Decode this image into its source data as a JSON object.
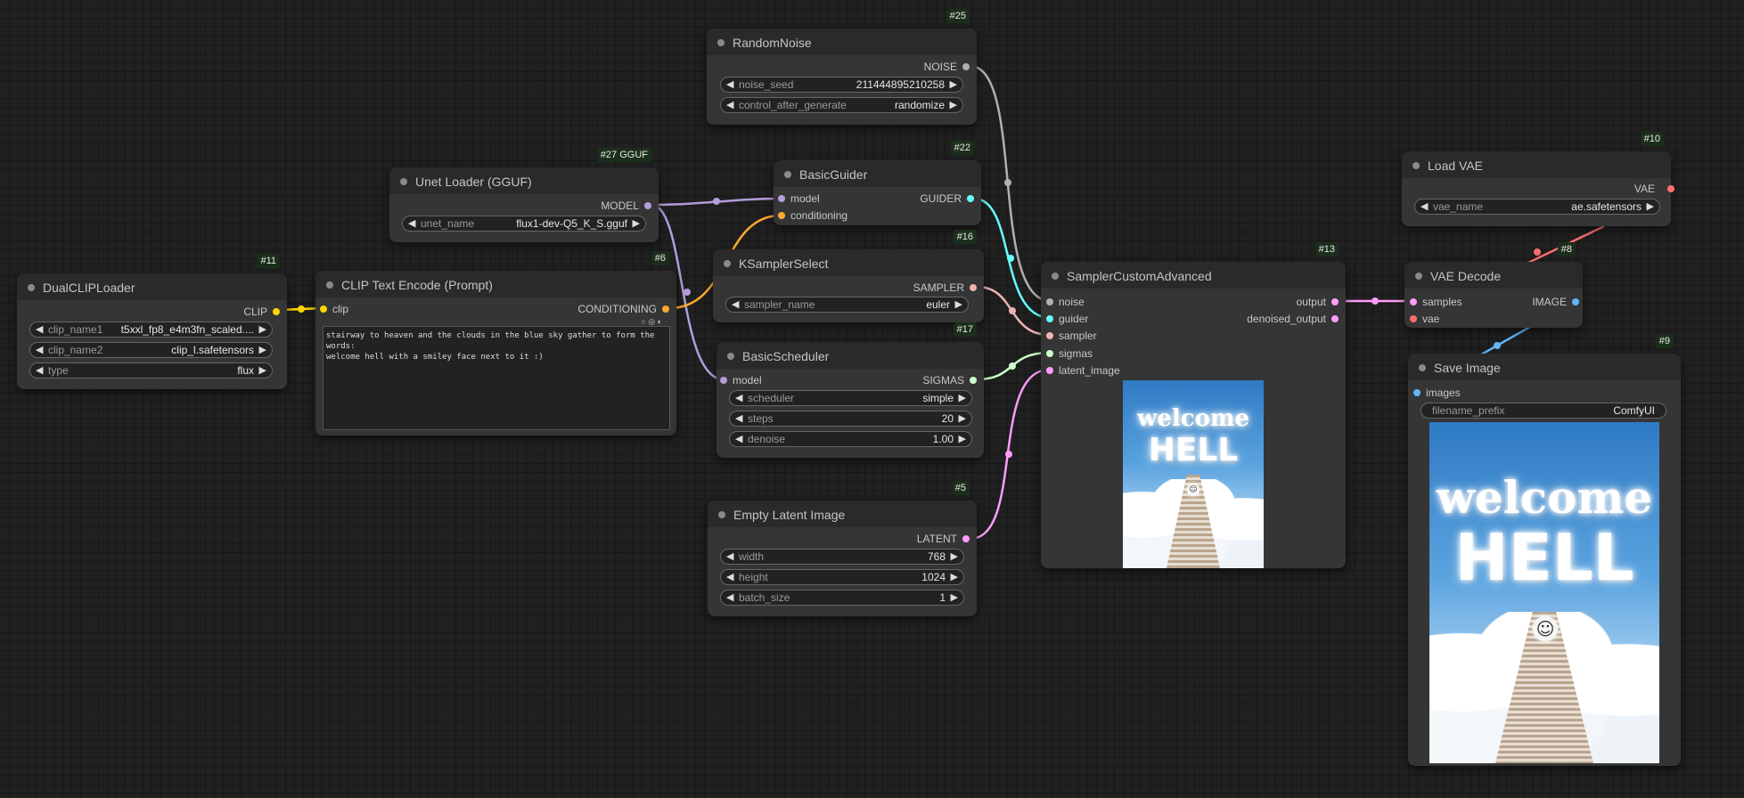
{
  "colors": {
    "model": "#b39ddb",
    "conditioning": "#ffa931",
    "clip": "#ffd500",
    "noise": "#b0b0b0",
    "guider": "#66ffff",
    "sampler": "#ecb4b4",
    "sigmas": "#cdffcd",
    "latent": "#ff9cf9",
    "image": "#64b5f6",
    "vae": "#ff6e6e"
  },
  "nodes": {
    "random_noise": {
      "badge": "#25",
      "title": "RandomNoise",
      "out_noise": "NOISE",
      "w_seed_label": "noise_seed",
      "w_seed_value": "211444895210258",
      "w_cag_label": "control_after_generate",
      "w_cag_value": "randomize"
    },
    "unet_loader": {
      "badge": "#27 GGUF",
      "title": "Unet Loader (GGUF)",
      "out_model": "MODEL",
      "w_unet_label": "unet_name",
      "w_unet_value": "flux1-dev-Q5_K_S.gguf"
    },
    "basic_guider": {
      "badge": "#22",
      "title": "BasicGuider",
      "in_model": "model",
      "in_conditioning": "conditioning",
      "out_guider": "GUIDER"
    },
    "dual_clip": {
      "badge": "#11",
      "title": "DualCLIPLoader",
      "out_clip": "CLIP",
      "w1_label": "clip_name1",
      "w1_value": "t5xxl_fp8_e4m3fn_scaled....",
      "w2_label": "clip_name2",
      "w2_value": "clip_l.safetensors",
      "w3_label": "type",
      "w3_value": "flux"
    },
    "clip_text": {
      "badge": "#6",
      "title": "CLIP Text Encode (Prompt)",
      "in_clip": "clip",
      "out_conditioning": "CONDITIONING",
      "prompt": "stairway to heaven and the clouds in the blue sky gather to form the words:\nwelcome hell with a smiley face next to it :)"
    },
    "ksampler_select": {
      "badge": "#16",
      "title": "KSamplerSelect",
      "out_sampler": "SAMPLER",
      "w_label": "sampler_name",
      "w_value": "euler"
    },
    "basic_scheduler": {
      "badge": "#17",
      "title": "BasicScheduler",
      "in_model": "model",
      "out_sigmas": "SIGMAS",
      "w1_label": "scheduler",
      "w1_value": "simple",
      "w2_label": "steps",
      "w2_value": "20",
      "w3_label": "denoise",
      "w3_value": "1.00"
    },
    "empty_latent": {
      "badge": "#5",
      "title": "Empty Latent Image",
      "out_latent": "LATENT",
      "w1_label": "width",
      "w1_value": "768",
      "w2_label": "height",
      "w2_value": "1024",
      "w3_label": "batch_size",
      "w3_value": "1"
    },
    "sampler_custom": {
      "badge": "#13",
      "title": "SamplerCustomAdvanced",
      "in_noise": "noise",
      "in_guider": "guider",
      "in_sampler": "sampler",
      "in_sigmas": "sigmas",
      "in_latent": "latent_image",
      "out_output": "output",
      "out_denoised": "denoised_output",
      "preview_line1": "welcome",
      "preview_line2": "HELL"
    },
    "load_vae": {
      "badge": "#10",
      "title": "Load VAE",
      "out_vae": "VAE",
      "w_label": "vae_name",
      "w_value": "ae.safetensors"
    },
    "vae_decode": {
      "badge": "#8",
      "title": "VAE Decode",
      "in_samples": "samples",
      "in_vae": "vae",
      "out_image": "IMAGE"
    },
    "save_image": {
      "badge": "#9",
      "title": "Save Image",
      "in_images": "images",
      "w_label": "filename_prefix",
      "w_value": "ComfyUI",
      "preview_line1": "welcome",
      "preview_line2": "HELL"
    }
  }
}
